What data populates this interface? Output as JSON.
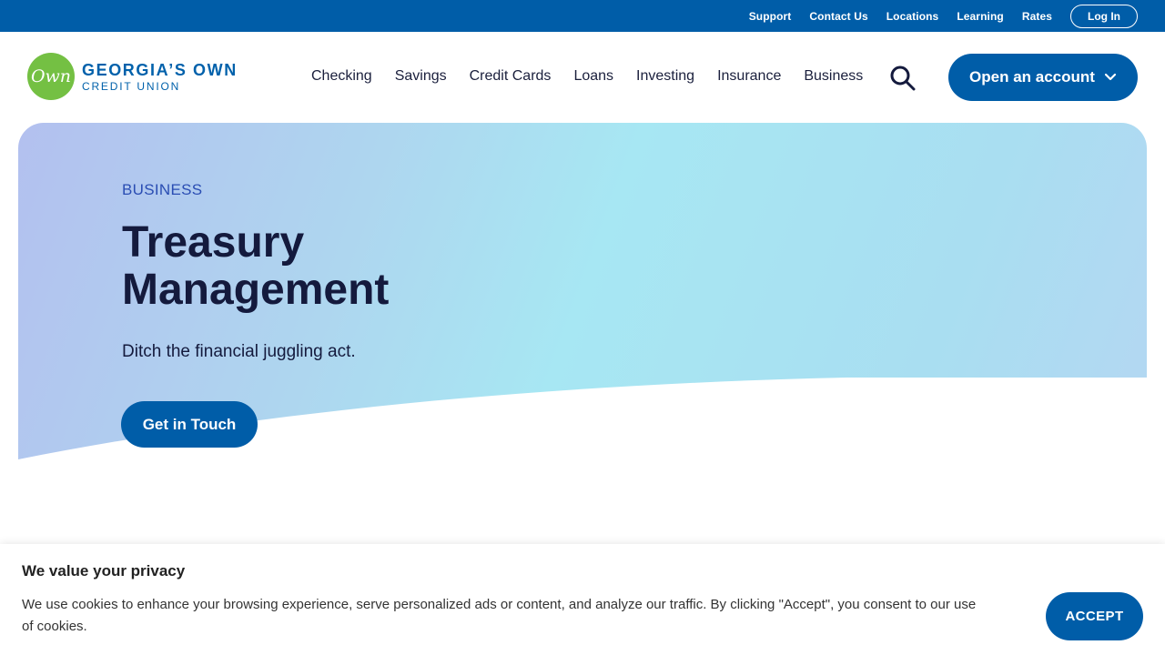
{
  "utility_nav": {
    "links": [
      "Support",
      "Contact Us",
      "Locations",
      "Learning",
      "Rates"
    ],
    "login_label": "Log In"
  },
  "brand": {
    "badge": "Own",
    "title": "GEORGIA’S OWN",
    "subtitle": "CREDIT UNION"
  },
  "main_nav": {
    "items": [
      "Checking",
      "Savings",
      "Credit Cards",
      "Loans",
      "Investing",
      "Insurance",
      "Business"
    ],
    "search_icon": "search-icon",
    "open_account_label": "Open an account"
  },
  "hero": {
    "eyebrow": "BUSINESS",
    "title": "Treasury Management",
    "subtitle": "Ditch the financial juggling act.",
    "cta_label": "Get in Touch"
  },
  "cookie_banner": {
    "title": "We value your privacy",
    "text": "We use cookies to enhance your browsing experience, serve personalized ads or content, and analyze our traffic. By clicking \"Accept\", you consent to our use of cookies.",
    "accept_label": "ACCEPT"
  },
  "colors": {
    "brand_blue": "#005da8",
    "logo_green": "#74c043",
    "text_dark": "#141a3d"
  }
}
